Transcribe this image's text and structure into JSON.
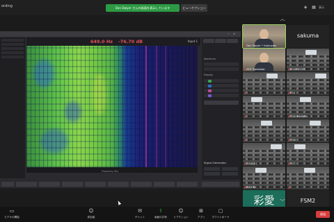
{
  "topbar": {
    "recording_label": "ording",
    "share_banner": "Dan Dwyer さんの画面を表示しています",
    "view_options": "ビューオプション",
    "view_label": "表示"
  },
  "app": {
    "title": "",
    "frequency": "649.0 Hz",
    "level": "-76.70 dB",
    "input_tag": "Input 1",
    "freq_axis_title": "Frequency (Hz)",
    "panel_section_spectrum": "Spectrum",
    "panel_section_display": "Display",
    "signal_generator": "Signal Generator",
    "right_tabs": [
      "",
      "",
      ""
    ],
    "channels": [
      {
        "label": "",
        "color": "#3aa651"
      },
      {
        "label": "",
        "color": "#2f6fd0"
      },
      {
        "label": "",
        "color": "#c04a9c"
      },
      {
        "label": "",
        "color": "#7a5ad0"
      }
    ],
    "add_button": ""
  },
  "gallery": {
    "participants": [
      {
        "name": "Dan Dwyer • Instructor",
        "kind": "video",
        "active": true
      },
      {
        "name": "sakuma",
        "kind": "name"
      },
      {
        "name": "KYU Translator",
        "kind": "video"
      },
      {
        "name": "KOBE KOYO",
        "kind": "classroom"
      },
      {
        "name": "",
        "kind": "classroom"
      },
      {
        "name": "FSU",
        "kind": "classroom"
      },
      {
        "name": "",
        "kind": "classroom"
      },
      {
        "name": "TSM SHIBUYA",
        "kind": "classroom"
      },
      {
        "name": "",
        "kind": "classroom"
      },
      {
        "name": "TSM",
        "kind": "classroom"
      },
      {
        "name": "OSW_21",
        "kind": "classroom"
      },
      {
        "name": "TOT",
        "kind": "classroom"
      },
      {
        "name": "NSM Kit",
        "kind": "classroom"
      },
      {
        "name": "",
        "kind": "classroom"
      },
      {
        "name": "KOYO",
        "kind": "kanji",
        "kanji": "彩愛"
      },
      {
        "name": "FSM2",
        "kind": "name"
      }
    ]
  },
  "toolbar": {
    "buttons": [
      {
        "icon": "video-icon",
        "glyph": "▭",
        "label": "ビデオの開始"
      },
      {
        "icon": "participants-icon",
        "glyph": "☺",
        "label": "参加者"
      },
      {
        "icon": "chat-icon",
        "glyph": "✉",
        "label": "チャット"
      },
      {
        "icon": "share-screen-icon",
        "glyph": "⇧",
        "label": "画面の共有"
      },
      {
        "icon": "reactions-icon",
        "glyph": "☺",
        "label": "リアクション"
      },
      {
        "icon": "apps-icon",
        "glyph": "⊞",
        "label": "アプリ"
      },
      {
        "icon": "whiteboard-icon",
        "glyph": "▢",
        "label": "ホワイトボード"
      }
    ],
    "end_label": "退出"
  }
}
